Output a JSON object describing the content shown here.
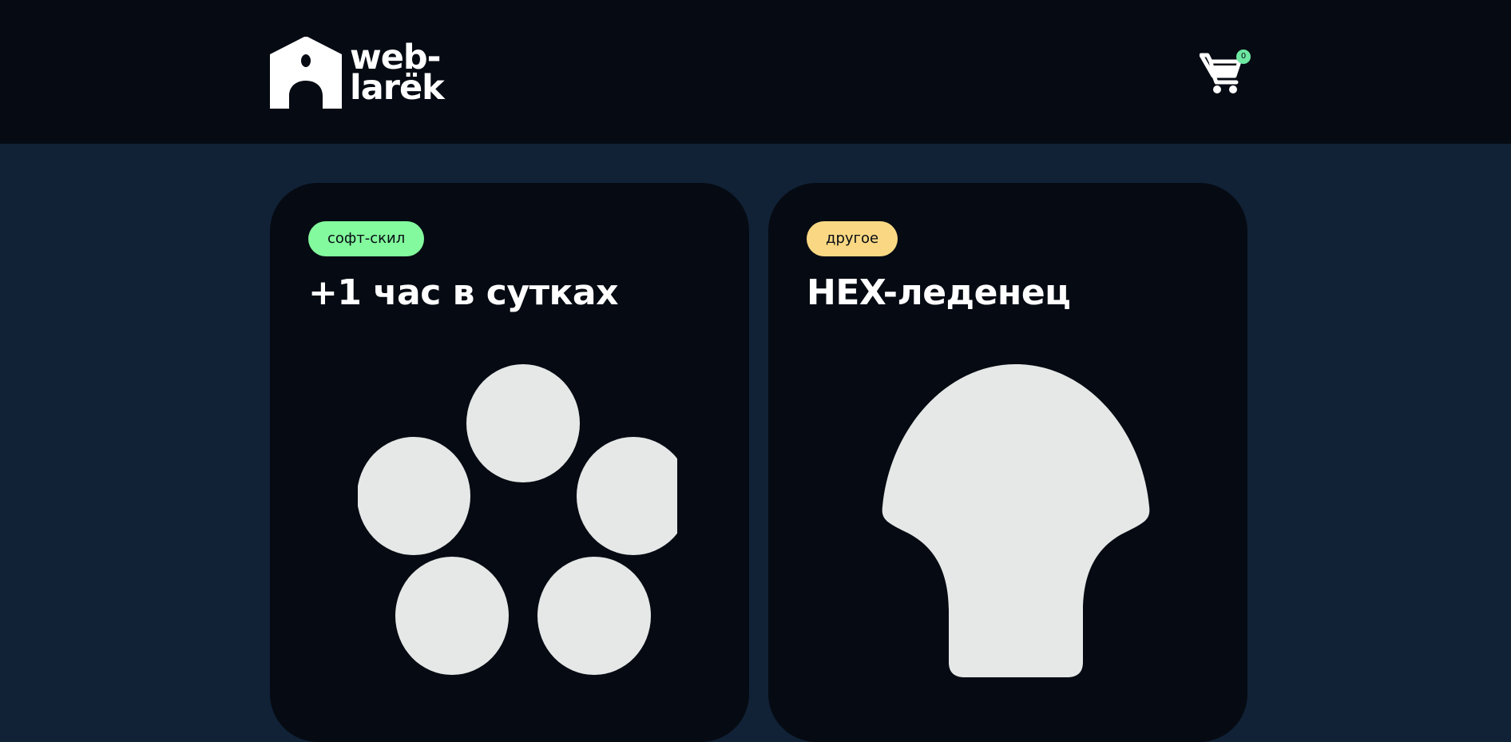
{
  "header": {
    "logo": {
      "line1": "web-",
      "line2": "larëk",
      "icon": "house-icon"
    },
    "cart": {
      "icon": "cart-icon",
      "counter": "0"
    }
  },
  "gallery": {
    "cards": [
      {
        "category": "софт-скил",
        "category_color": "#83fa9d",
        "title": "+1 час в сутках",
        "image": "five-circles-icon"
      },
      {
        "category": "другое",
        "category_color": "#fad883",
        "title": "HEX-леденец",
        "image": "lollipop-shape-icon"
      }
    ]
  },
  "colors": {
    "header_bg": "#060b13",
    "page_bg": "#112237",
    "card_bg": "#060b13",
    "shape_fill": "#e6e8e7"
  }
}
